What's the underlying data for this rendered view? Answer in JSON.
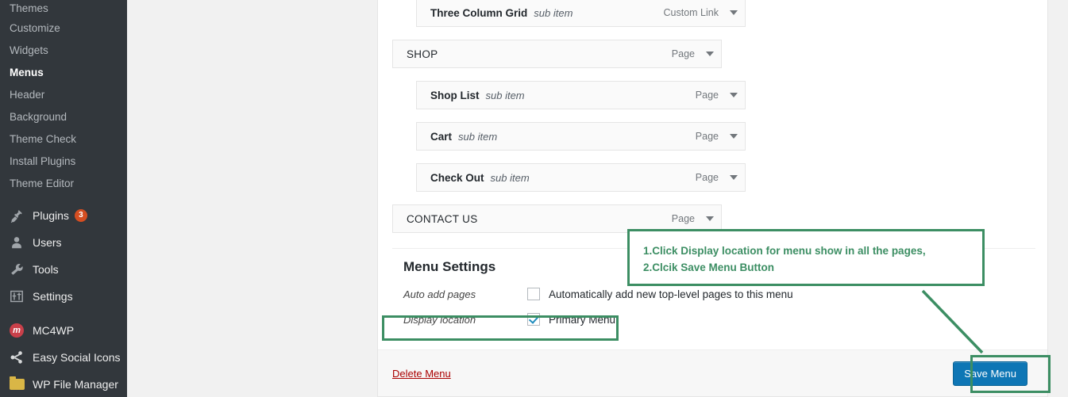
{
  "sidebar": {
    "sub_items": [
      {
        "label": "Themes",
        "active": false
      },
      {
        "label": "Customize",
        "active": false
      },
      {
        "label": "Widgets",
        "active": false
      },
      {
        "label": "Menus",
        "active": true
      },
      {
        "label": "Header",
        "active": false
      },
      {
        "label": "Background",
        "active": false
      },
      {
        "label": "Theme Check",
        "active": false
      },
      {
        "label": "Install Plugins",
        "active": false
      },
      {
        "label": "Theme Editor",
        "active": false
      }
    ],
    "top_items": [
      {
        "label": "Plugins",
        "icon": "plug-icon",
        "badge": "3"
      },
      {
        "label": "Users",
        "icon": "user-icon",
        "badge": ""
      },
      {
        "label": "Tools",
        "icon": "wrench-icon",
        "badge": ""
      },
      {
        "label": "Settings",
        "icon": "sliders-icon",
        "badge": ""
      }
    ],
    "plugin_items": [
      {
        "label": "MC4WP",
        "icon": "mc4wp-icon"
      },
      {
        "label": "Easy Social Icons",
        "icon": "share-icon"
      },
      {
        "label": "WP File Manager",
        "icon": "folder-icon"
      }
    ]
  },
  "menu_items": [
    {
      "title": "Three Column Grid",
      "sub_label": "sub item",
      "type": "Custom Link",
      "depth": 1,
      "plain": false
    },
    {
      "title": "SHOP",
      "sub_label": "",
      "type": "Page",
      "depth": 0,
      "plain": true
    },
    {
      "title": "Shop List",
      "sub_label": "sub item",
      "type": "Page",
      "depth": 1,
      "plain": false
    },
    {
      "title": "Cart",
      "sub_label": "sub item",
      "type": "Page",
      "depth": 1,
      "plain": false
    },
    {
      "title": "Check Out",
      "sub_label": "sub item",
      "type": "Page",
      "depth": 1,
      "plain": false
    },
    {
      "title": "CONTACT US",
      "sub_label": "",
      "type": "Page",
      "depth": 0,
      "plain": true
    }
  ],
  "menu_settings": {
    "heading": "Menu Settings",
    "auto_add_label": "Auto add pages",
    "auto_add_checkbox_text": "Automatically add new top-level pages to this menu",
    "auto_add_checked": false,
    "display_location_label": "Display location",
    "display_location_checkbox_text": "Primary Menu",
    "display_location_checked": true
  },
  "footer": {
    "delete_label": "Delete Menu",
    "save_label": "Save Menu"
  },
  "annotation": {
    "line1": "1.Click Display location for menu show in all the pages,",
    "line2": "2.Clcik Save Menu Button",
    "color": "#3c8e63"
  }
}
